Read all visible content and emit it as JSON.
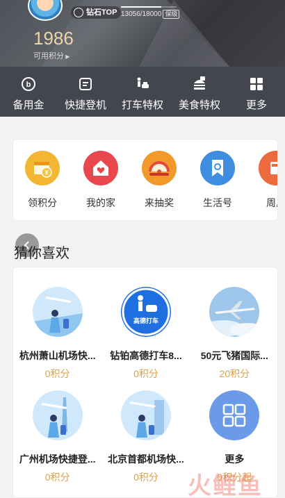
{
  "header": {
    "level_label": "钻石TOP",
    "progress_text": "13056/18000",
    "progress_tag": "保级",
    "progress_fraction": 0.725,
    "points_value": "1986",
    "points_label": "可用积分"
  },
  "quickbar": [
    {
      "label": "备用金",
      "icon": "coin-b-icon"
    },
    {
      "label": "快捷登机",
      "icon": "boarding-pass-icon"
    },
    {
      "label": "打车特权",
      "icon": "taxi-person-icon"
    },
    {
      "label": "美食特权",
      "icon": "burger-icon"
    },
    {
      "label": "更多",
      "icon": "grid-icon"
    }
  ],
  "services": [
    {
      "label": "领积分",
      "icon": "calendar-coin-icon",
      "color": "#f2b632"
    },
    {
      "label": "我的家",
      "icon": "house-heart-icon",
      "color": "#e8474d"
    },
    {
      "label": "来抽奖",
      "icon": "lottery-wheel-icon",
      "color": "#f19a2b"
    },
    {
      "label": "生活号",
      "icon": "bookmark-icon",
      "color": "#3f8de0"
    },
    {
      "label": "周周",
      "icon": "gift-icon",
      "color": "#ec6a3d"
    }
  ],
  "section_title": "猜你喜欢",
  "guess": [
    {
      "name": "杭州萧山机场快...",
      "price": "0积分",
      "icon": "airport-walker-icon"
    },
    {
      "name": "钻铂高德打车8...",
      "price": "0积分",
      "icon": "amap-taxi-icon",
      "badge": "高德打车"
    },
    {
      "name": "50元飞猪国际...",
      "price": "20积分",
      "icon": "airplane-sky-icon"
    },
    {
      "name": "广州机场快捷登...",
      "price": "0积分",
      "icon": "airport-walker-icon"
    },
    {
      "name": "北京首都机场快...",
      "price": "0积分",
      "icon": "airport-walker-icon"
    },
    {
      "name": "更多",
      "price": "0积分起",
      "icon": "more-grid-icon"
    }
  ],
  "watermark": "火鲤鱼",
  "colors": {
    "gold": "#d9a24a",
    "dark_bar": "#44464f",
    "more_blue": "#6b9be8"
  }
}
